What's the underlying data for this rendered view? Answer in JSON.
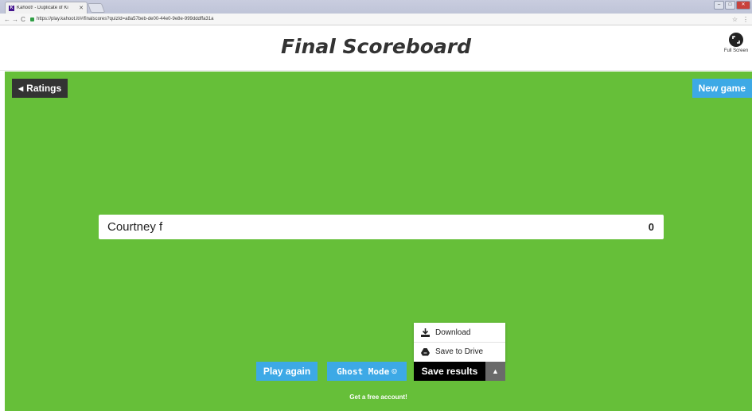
{
  "browser": {
    "tab_title": "Kahoot! - Duplicate of Ki",
    "url": "https://play.kahoot.it/#/finalscores?quizId=a8a57beb-de00-44e0-9e8e-999dddffa31a"
  },
  "header": {
    "title": "Final Scoreboard",
    "fullscreen_label": "Full Screen"
  },
  "stage": {
    "ratings_label": "Ratings",
    "new_game_label": "New game",
    "background_color": "#66bf39"
  },
  "scoreboard": {
    "rows": [
      {
        "name": "Courtney f",
        "score": "0"
      }
    ]
  },
  "save_menu": {
    "items": [
      {
        "label": "Download",
        "icon": "download-icon"
      },
      {
        "label": "Save to Drive",
        "icon": "drive-icon"
      }
    ]
  },
  "actions": {
    "play_again": "Play again",
    "ghost_mode": "Ghost Mode",
    "save_results": "Save results"
  },
  "footer": {
    "free_account": "Get a free account!"
  }
}
